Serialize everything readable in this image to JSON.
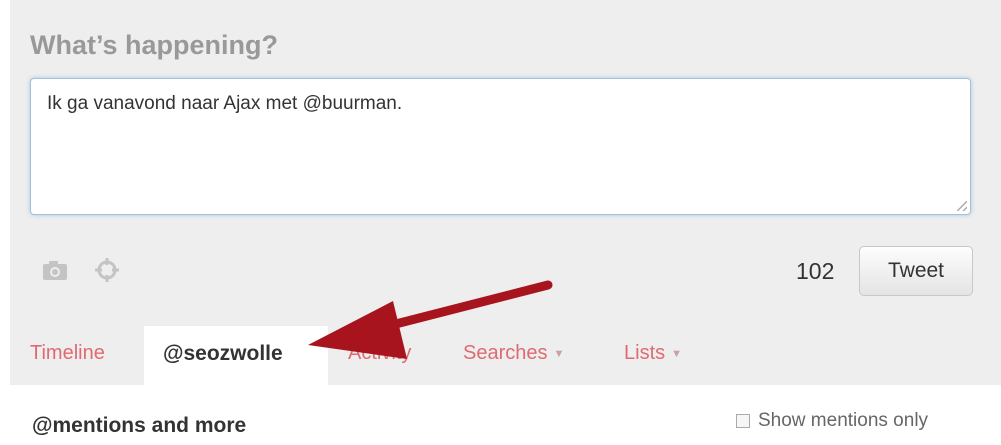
{
  "compose": {
    "heading": "What’s happening?",
    "tweet_text": "Ik ga vanavond naar Ajax met @buurman.",
    "char_count": "102",
    "tweet_label": "Tweet",
    "icons": [
      "camera-icon",
      "location-icon"
    ]
  },
  "tabs": {
    "timeline": "Timeline",
    "mentions": "@seozwolle",
    "activity": "Activity",
    "searches": "Searches",
    "lists": "Lists",
    "caret": "▼"
  },
  "section": {
    "title": "@mentions and more",
    "show_mentions_label": "Show mentions only"
  },
  "colors": {
    "tab_link": "#e06a72",
    "arrow": "#a8141d",
    "panel_bg": "#eeeeee"
  }
}
